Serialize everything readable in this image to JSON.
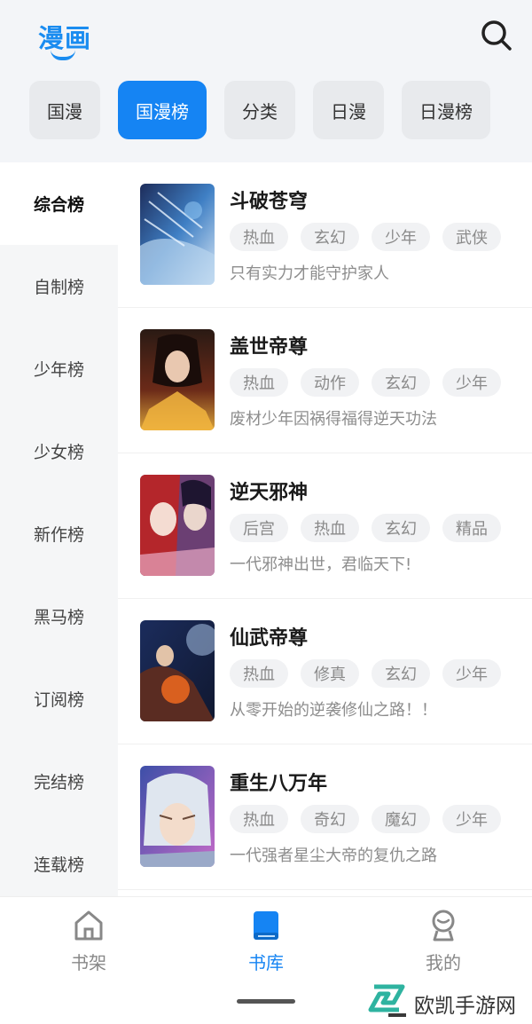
{
  "app": {
    "logo_text": "漫画"
  },
  "top_tabs": [
    {
      "label": "国漫",
      "active": false
    },
    {
      "label": "国漫榜",
      "active": true
    },
    {
      "label": "分类",
      "active": false
    },
    {
      "label": "日漫",
      "active": false
    },
    {
      "label": "日漫榜",
      "active": false
    }
  ],
  "sidebar": {
    "items": [
      {
        "label": "综合榜",
        "active": true
      },
      {
        "label": "自制榜"
      },
      {
        "label": "少年榜"
      },
      {
        "label": "少女榜"
      },
      {
        "label": "新作榜"
      },
      {
        "label": "黑马榜"
      },
      {
        "label": "订阅榜"
      },
      {
        "label": "完结榜"
      },
      {
        "label": "连载榜"
      }
    ]
  },
  "comics": [
    {
      "title": "斗破苍穹",
      "tags": [
        "热血",
        "玄幻",
        "少年",
        "武侠"
      ],
      "desc": "只有实力才能守护家人"
    },
    {
      "title": "盖世帝尊",
      "tags": [
        "热血",
        "动作",
        "玄幻",
        "少年"
      ],
      "desc": "废材少年因祸得福得逆天功法"
    },
    {
      "title": "逆天邪神",
      "tags": [
        "后宫",
        "热血",
        "玄幻",
        "精品"
      ],
      "desc": "一代邪神出世，君临天下!"
    },
    {
      "title": "仙武帝尊",
      "tags": [
        "热血",
        "修真",
        "玄幻",
        "少年"
      ],
      "desc": "从零开始的逆袭修仙之路！！"
    },
    {
      "title": "重生八万年",
      "tags": [
        "热血",
        "奇幻",
        "魔幻",
        "少年"
      ],
      "desc": "一代强者星尘大帝的复仇之路"
    }
  ],
  "bottom_nav": [
    {
      "label": "书架",
      "icon": "home-icon"
    },
    {
      "label": "书库",
      "icon": "book-icon",
      "active": true
    },
    {
      "label": "我的",
      "icon": "profile-icon"
    }
  ],
  "watermark": {
    "text": "欧凯手游网"
  },
  "colors": {
    "accent": "#1584f3",
    "logo": "#1a8cf0"
  }
}
